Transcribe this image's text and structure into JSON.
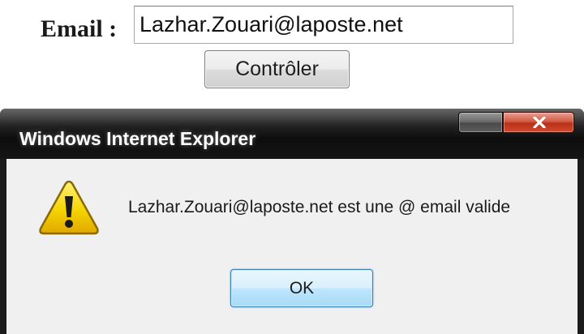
{
  "form": {
    "email_label": "Email :",
    "email_value": "Lazhar.Zouari@laposte.net",
    "check_button_label": "Contrôler"
  },
  "dialog": {
    "title": "Windows Internet Explorer",
    "icon": "warning-icon",
    "message": "Lazhar.Zouari@laposte.net est une @ email valide",
    "ok_label": "OK",
    "close_icon": "close-icon"
  },
  "colors": {
    "titlebar": "#0d0d0d",
    "close_button": "#c8391f",
    "dialog_body": "#f0f0f0",
    "warning_fill": "#f5d400",
    "ok_button_border": "#3c7fb1"
  }
}
